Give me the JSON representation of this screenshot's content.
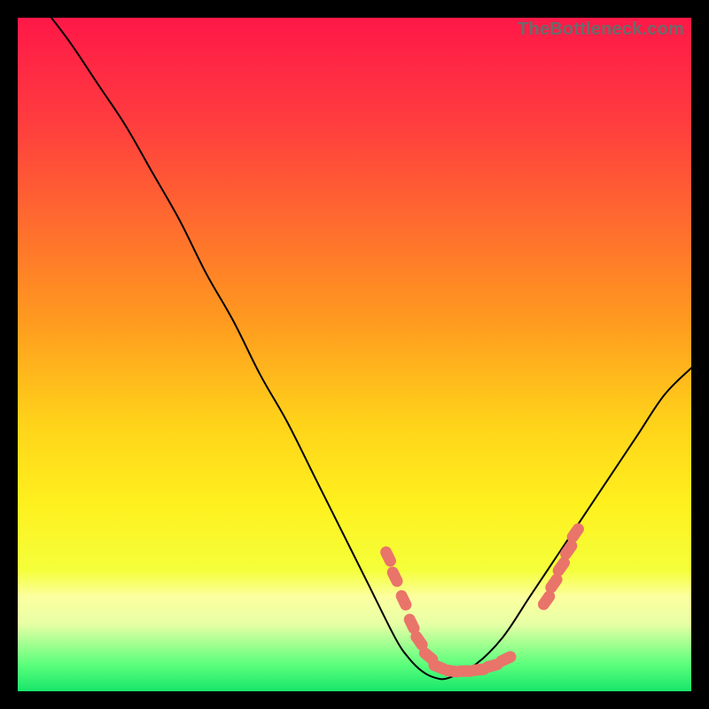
{
  "watermark": "TheBottleneck.com",
  "chart_data": {
    "type": "line",
    "title": "",
    "xlabel": "",
    "ylabel": "",
    "xlim": [
      0,
      100
    ],
    "ylim": [
      0,
      100
    ],
    "grid": false,
    "legend": false,
    "background_gradient": {
      "stops": [
        {
          "offset": 0.0,
          "color": "#ff1848"
        },
        {
          "offset": 0.15,
          "color": "#ff3b3f"
        },
        {
          "offset": 0.3,
          "color": "#ff6a2f"
        },
        {
          "offset": 0.45,
          "color": "#ff9a1f"
        },
        {
          "offset": 0.6,
          "color": "#ffd21a"
        },
        {
          "offset": 0.72,
          "color": "#fff01e"
        },
        {
          "offset": 0.82,
          "color": "#f4ff3a"
        },
        {
          "offset": 0.86,
          "color": "#fcffa0"
        },
        {
          "offset": 0.9,
          "color": "#e7ffa5"
        },
        {
          "offset": 0.96,
          "color": "#5cff7c"
        },
        {
          "offset": 1.0,
          "color": "#18e66b"
        }
      ]
    },
    "series": [
      {
        "name": "bottleneck-curve",
        "color": "#000000",
        "stroke_width": 2,
        "x": [
          5,
          8,
          12,
          16,
          20,
          24,
          28,
          32,
          36,
          40,
          44,
          48,
          52,
          56,
          58,
          60,
          62,
          64,
          68,
          72,
          76,
          80,
          84,
          88,
          92,
          96,
          100
        ],
        "y": [
          100,
          96,
          90,
          84,
          77,
          70,
          62,
          55,
          47,
          40,
          32,
          24,
          16,
          8,
          5,
          3,
          2,
          2,
          4,
          8,
          14,
          20,
          26,
          32,
          38,
          44,
          48
        ]
      }
    ],
    "marker_overlays": [
      {
        "name": "salmon-pills-left",
        "color": "#e9746a",
        "shape": "capsule",
        "points": [
          {
            "x": 55.0,
            "y": 20.0,
            "angle": 64
          },
          {
            "x": 56.0,
            "y": 17.0,
            "angle": 64
          },
          {
            "x": 57.3,
            "y": 13.5,
            "angle": 64
          },
          {
            "x": 58.5,
            "y": 10.0,
            "angle": 64
          },
          {
            "x": 59.6,
            "y": 7.5,
            "angle": 55
          },
          {
            "x": 61.0,
            "y": 5.2,
            "angle": 40
          }
        ]
      },
      {
        "name": "salmon-pills-bottom",
        "color": "#e9746a",
        "shape": "capsule",
        "points": [
          {
            "x": 62.5,
            "y": 3.6,
            "angle": 22
          },
          {
            "x": 64.5,
            "y": 3.0,
            "angle": 8
          },
          {
            "x": 66.5,
            "y": 3.0,
            "angle": 0
          },
          {
            "x": 68.5,
            "y": 3.2,
            "angle": -6
          },
          {
            "x": 70.5,
            "y": 3.8,
            "angle": -15
          },
          {
            "x": 72.5,
            "y": 4.8,
            "angle": -25
          }
        ]
      },
      {
        "name": "salmon-pills-right",
        "color": "#e9746a",
        "shape": "capsule",
        "points": [
          {
            "x": 78.5,
            "y": 13.5,
            "angle": -55
          },
          {
            "x": 79.6,
            "y": 16.0,
            "angle": -55
          },
          {
            "x": 80.7,
            "y": 18.5,
            "angle": -55
          },
          {
            "x": 81.8,
            "y": 21.0,
            "angle": -55
          },
          {
            "x": 82.8,
            "y": 23.5,
            "angle": -55
          }
        ]
      }
    ]
  }
}
